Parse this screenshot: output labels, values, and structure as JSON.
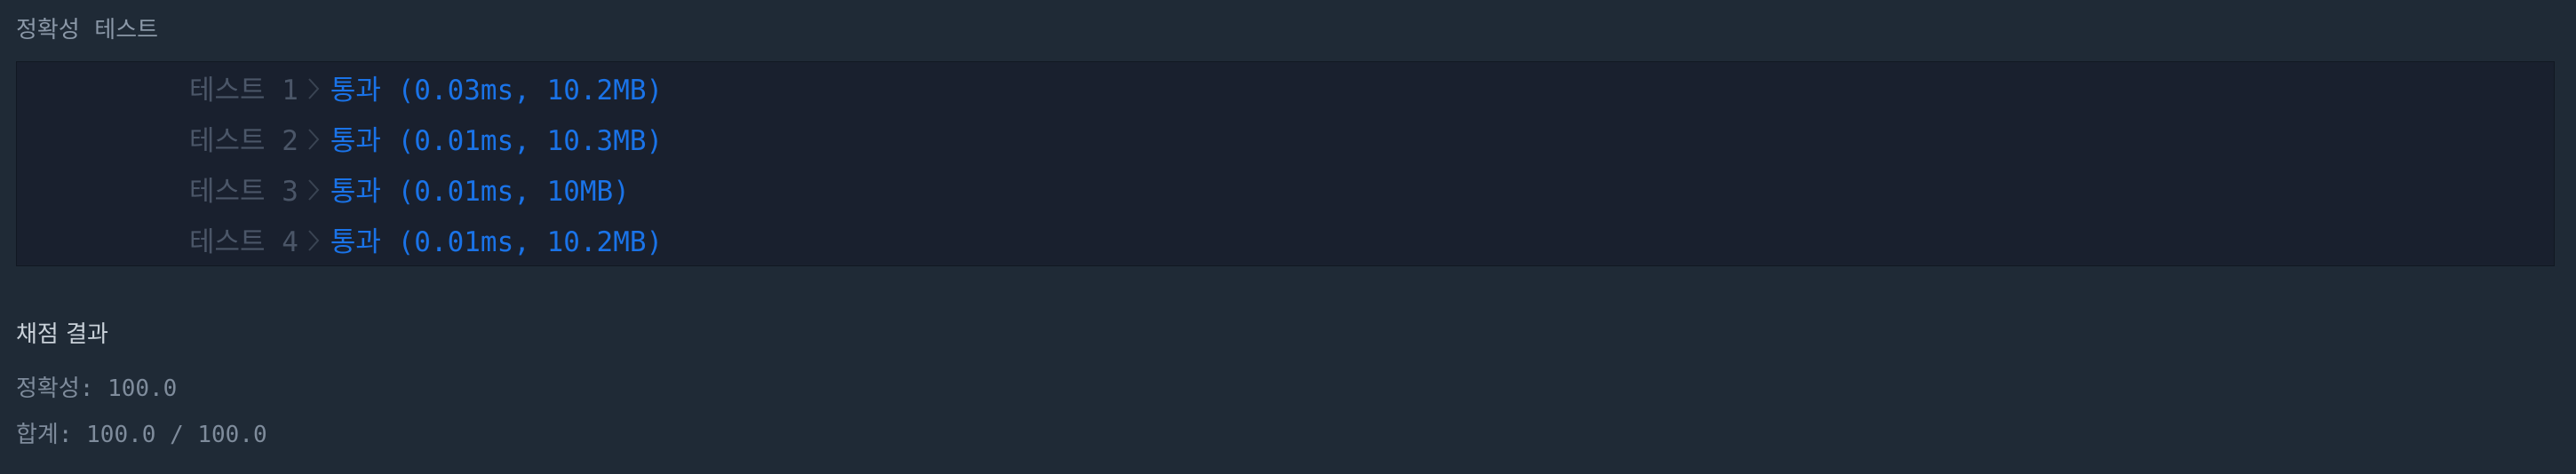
{
  "accuracy_section": {
    "title": "정확성  테스트"
  },
  "tests": [
    {
      "label": "테스트 1",
      "result": "통과 (0.03ms, 10.2MB)"
    },
    {
      "label": "테스트 2",
      "result": "통과 (0.01ms, 10.3MB)"
    },
    {
      "label": "테스트 3",
      "result": "통과 (0.01ms, 10MB)"
    },
    {
      "label": "테스트 4",
      "result": "통과 (0.01ms, 10.2MB)"
    }
  ],
  "grading": {
    "title": "채점 결과",
    "accuracy": "정확성: 100.0",
    "total": "합계: 100.0 / 100.0"
  },
  "colors": {
    "background": "#1f2a36",
    "box_background": "#19202e",
    "pass": "#1a73e8",
    "label": "#4b5668"
  },
  "icons": {
    "separator": "chevron-right-icon"
  }
}
